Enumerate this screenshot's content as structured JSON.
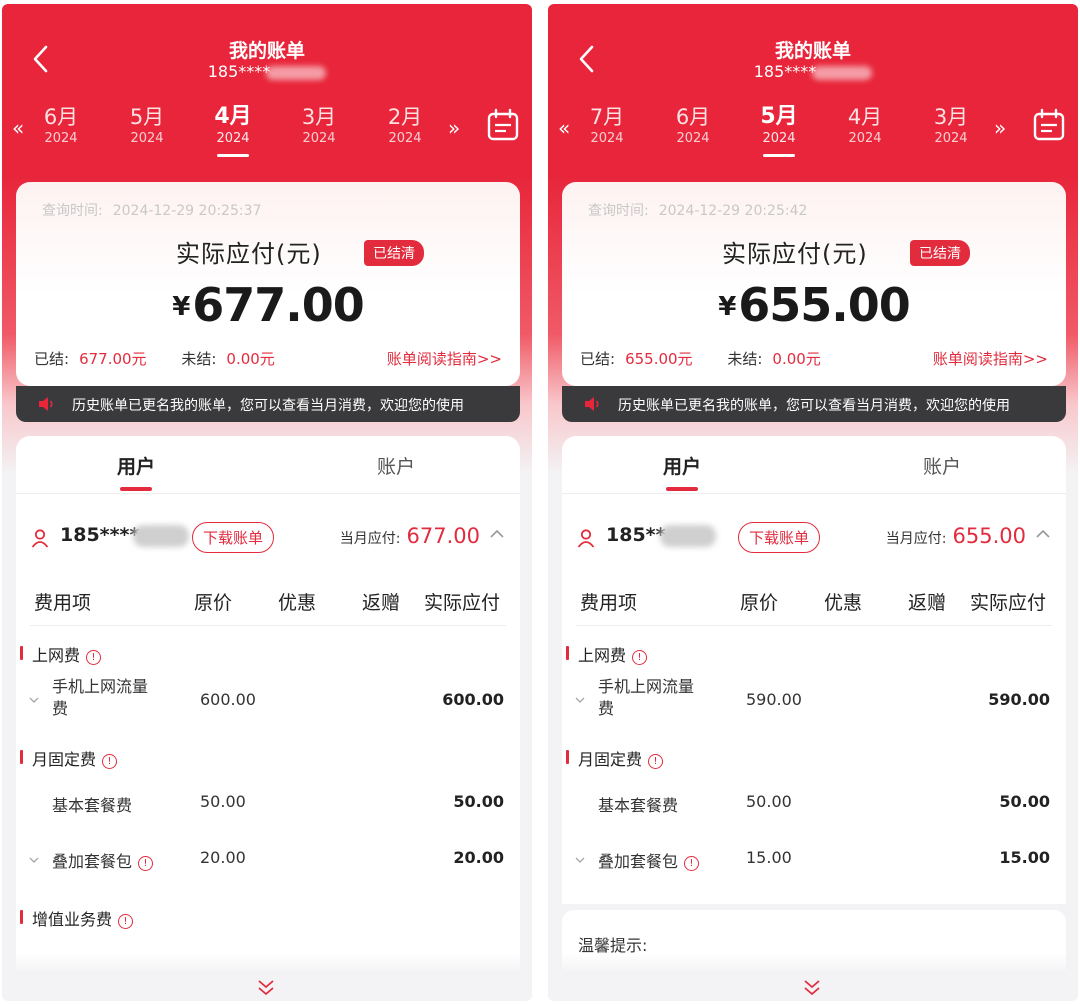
{
  "panels": [
    {
      "title": "我的账单",
      "phone": "185****",
      "months": [
        {
          "m": "6月",
          "y": "2024"
        },
        {
          "m": "5月",
          "y": "2024"
        },
        {
          "m": "4月",
          "y": "2024"
        },
        {
          "m": "3月",
          "y": "2024"
        },
        {
          "m": "2月",
          "y": "2024"
        }
      ],
      "active_month_index": 2,
      "query_label": "查询时间:",
      "query_time": "2024-12-29 20:25:37",
      "pay_label": "实际应付(元)",
      "status": "已结清",
      "currency": "¥",
      "amount": "677.00",
      "paid_label": "已结:",
      "paid_value": "677.00元",
      "unpaid_label": "未结:",
      "unpaid_value": "0.00元",
      "guide": "账单阅读指南>>",
      "notice": "历史账单已更名我的账单，您可以查看当月消费，欢迎您的使用",
      "tabs": [
        "用户",
        "账户"
      ],
      "user_phone": "185****",
      "download": "下载账单",
      "cur_pay_label": "当月应付:",
      "cur_pay_value": "677.00",
      "table_headers": [
        "费用项",
        "原价",
        "优惠",
        "返赠",
        "实际应付"
      ],
      "groups": [
        {
          "name": "上网费",
          "items": [
            {
              "name1": "手机上网流量",
              "name2": "费",
              "orig": "600.00",
              "actual": "600.00"
            }
          ]
        },
        {
          "name": "月固定费",
          "items": [
            {
              "name": "基本套餐费",
              "orig": "50.00",
              "actual": "50.00"
            },
            {
              "name": "叠加套餐包",
              "orig": "20.00",
              "actual": "20.00"
            }
          ]
        },
        {
          "name": "增值业务费"
        }
      ]
    },
    {
      "title": "我的账单",
      "phone": "185****",
      "months": [
        {
          "m": "7月",
          "y": "2024"
        },
        {
          "m": "6月",
          "y": "2024"
        },
        {
          "m": "5月",
          "y": "2024"
        },
        {
          "m": "4月",
          "y": "2024"
        },
        {
          "m": "3月",
          "y": "2024"
        }
      ],
      "active_month_index": 2,
      "query_label": "查询时间:",
      "query_time": "2024-12-29 20:25:42",
      "pay_label": "实际应付(元)",
      "status": "已结清",
      "currency": "¥",
      "amount": "655.00",
      "paid_label": "已结:",
      "paid_value": "655.00元",
      "unpaid_label": "未结:",
      "unpaid_value": "0.00元",
      "guide": "账单阅读指南>>",
      "notice": "历史账单已更名我的账单，您可以查看当月消费，欢迎您的使用",
      "tabs": [
        "用户",
        "账户"
      ],
      "user_phone": "185**",
      "download": "下载账单",
      "cur_pay_label": "当月应付:",
      "cur_pay_value": "655.00",
      "table_headers": [
        "费用项",
        "原价",
        "优惠",
        "返赠",
        "实际应付"
      ],
      "groups": [
        {
          "name": "上网费",
          "items": [
            {
              "name1": "手机上网流量",
              "name2": "费",
              "orig": "590.00",
              "actual": "590.00"
            }
          ]
        },
        {
          "name": "月固定费",
          "items": [
            {
              "name": "基本套餐费",
              "orig": "50.00",
              "actual": "50.00"
            },
            {
              "name": "叠加套餐包",
              "orig": "15.00",
              "actual": "15.00"
            }
          ]
        }
      ],
      "tip": "温馨提示:"
    }
  ],
  "colors": {
    "brand_red": "#e8253a",
    "accent_red": "#e22c3e",
    "notice_bg": "#3a3a3c"
  },
  "icons": [
    "back-arrow-icon",
    "double-chevron-left-icon",
    "double-chevron-right-icon",
    "calendar-icon",
    "speaker-icon",
    "user-icon",
    "chevron-up-icon",
    "info-icon",
    "chevron-down-icon",
    "double-chevron-down-icon"
  ]
}
